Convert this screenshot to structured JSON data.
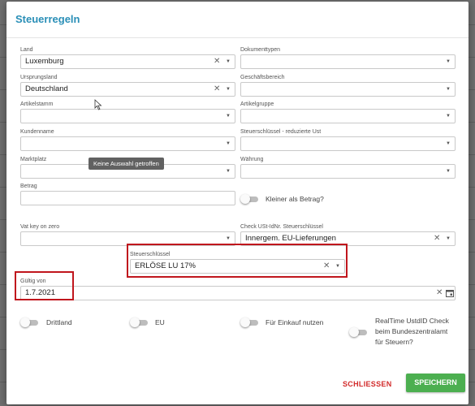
{
  "dialog": {
    "title": "Steuerregeln",
    "buttons": {
      "close_label": "SCHLIESSEN",
      "save_label": "SPEICHERN"
    }
  },
  "fields": {
    "land": {
      "label": "Land",
      "value": "Luxemburg"
    },
    "dokumenttypen": {
      "label": "Dokumenttypen",
      "value": ""
    },
    "ursprungsland": {
      "label": "Ursprungsland",
      "value": "Deutschland"
    },
    "geschaeftsbereich": {
      "label": "Geschäftsbereich",
      "value": ""
    },
    "artikelstamm": {
      "label": "Artikelstamm",
      "value": ""
    },
    "artikelgruppe": {
      "label": "Artikelgruppe",
      "value": ""
    },
    "kundenname": {
      "label": "Kundenname",
      "value": ""
    },
    "steuerschluessel_reduziert": {
      "label": "Steuerschlüssel - reduzierte Ust",
      "value": ""
    },
    "marktplatz": {
      "label": "Marktplatz",
      "value": ""
    },
    "waehrung": {
      "label": "Währung",
      "value": ""
    },
    "betrag": {
      "label": "Betrag",
      "value": ""
    },
    "vat_key_on_zero": {
      "label": "Vat key on zero",
      "value": ""
    },
    "check_ustid": {
      "label": "Check USt-IdNr. Steuerschlüssel",
      "value": "Innergem. EU-Lieferungen"
    },
    "steuerschluessel": {
      "label": "Steuerschlüssel",
      "value": "ERLÖSE LU 17%"
    },
    "gueltig_von": {
      "label": "Gültig von",
      "value": "1.7.2021"
    }
  },
  "toggles": {
    "kleiner_als_betrag": "Kleiner als Betrag?",
    "drittland": "Drittland",
    "eu": "EU",
    "fuer_einkauf": "Für Einkauf nutzen",
    "realtime_line1": "RealTime UstdID Check",
    "realtime_line2": "beim Bundeszentralamt",
    "realtime_line3": "für Steuern?"
  },
  "tooltip": "Keine Auswahl getroffen",
  "colors": {
    "title": "#2a8fb7",
    "highlight": "#c0161d",
    "save": "#4caf50",
    "close": "#d22a2a"
  }
}
